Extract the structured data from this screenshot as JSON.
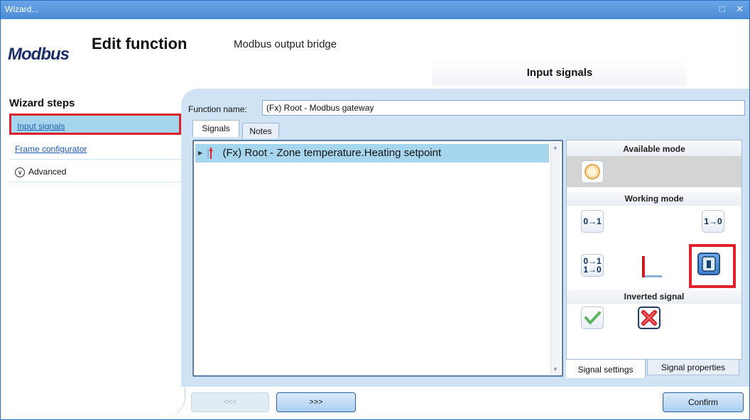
{
  "window": {
    "title": "Wizard...",
    "controls": "□ ✕"
  },
  "header": {
    "logo_text": "Modbus",
    "title": "Edit function",
    "subtitle": "Modbus output bridge",
    "tab_title": "Input signals"
  },
  "sidebar": {
    "title": "Wizard steps",
    "items": [
      {
        "label": "Input signals"
      },
      {
        "label": "Frame configurator"
      },
      {
        "label": "Advanced"
      }
    ]
  },
  "form": {
    "function_name_label": "Function name:",
    "function_name_value": "(Fx) Root - Modbus gateway"
  },
  "tabs": [
    {
      "label": "Signals"
    },
    {
      "label": "Notes"
    }
  ],
  "signals": [
    {
      "label": "(Fx) Root - Zone temperature.Heating setpoint"
    }
  ],
  "modes": {
    "available_title": "Available mode",
    "working_title": "Working mode",
    "inverted_title": "Inverted signal",
    "btn_01": "0→1",
    "btn_10": "1→0",
    "btn_0110_top": "0→1",
    "btn_0110_bottom": "1→0"
  },
  "pane_tabs": [
    {
      "label": "Signal settings"
    },
    {
      "label": "Signal properties"
    }
  ],
  "footer": {
    "prev": "<<<",
    "next": ">>>",
    "confirm": "Confirm"
  },
  "colors": {
    "accent": "#a6d6ee",
    "highlight_border": "#e0202a",
    "title_bar": "#4b8ad6"
  }
}
